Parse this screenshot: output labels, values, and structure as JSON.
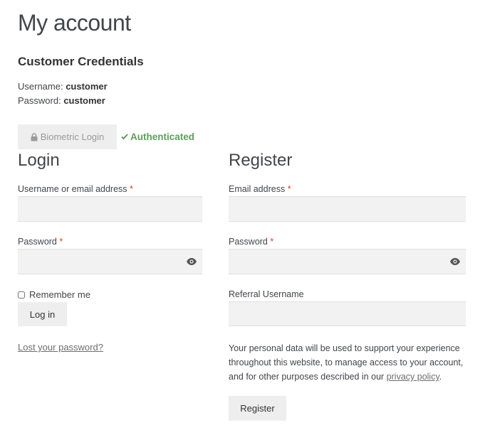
{
  "page": {
    "title": "My account"
  },
  "credentials": {
    "heading": "Customer Credentials",
    "username_label": "Username:",
    "username_value": "customer",
    "password_label": "Password:",
    "password_value": "customer"
  },
  "biometric": {
    "button_label": "Biometric Login",
    "status_text": "Authenticated",
    "status_color": "#5a9f5a"
  },
  "login": {
    "heading": "Login",
    "username_label": "Username or email address",
    "password_label": "Password",
    "remember_label": "Remember me",
    "submit_label": "Log in",
    "lost_password": "Lost your password?"
  },
  "register": {
    "heading": "Register",
    "email_label": "Email address",
    "password_label": "Password",
    "referral_label": "Referral Username",
    "privacy_text_before": "Your personal data will be used to support your experience throughout this website, to manage access to your account, and for other purposes described in our",
    "privacy_link": "privacy policy",
    "privacy_text_after": ".",
    "submit_label": "Register"
  },
  "required_marker": "*",
  "icons": {
    "lock": "lock-icon",
    "check": "check-icon",
    "eye": "eye-icon"
  },
  "colors": {
    "required": "#e2401c",
    "field_bg": "#f2f2f2",
    "button_bg": "#eeeeee"
  }
}
